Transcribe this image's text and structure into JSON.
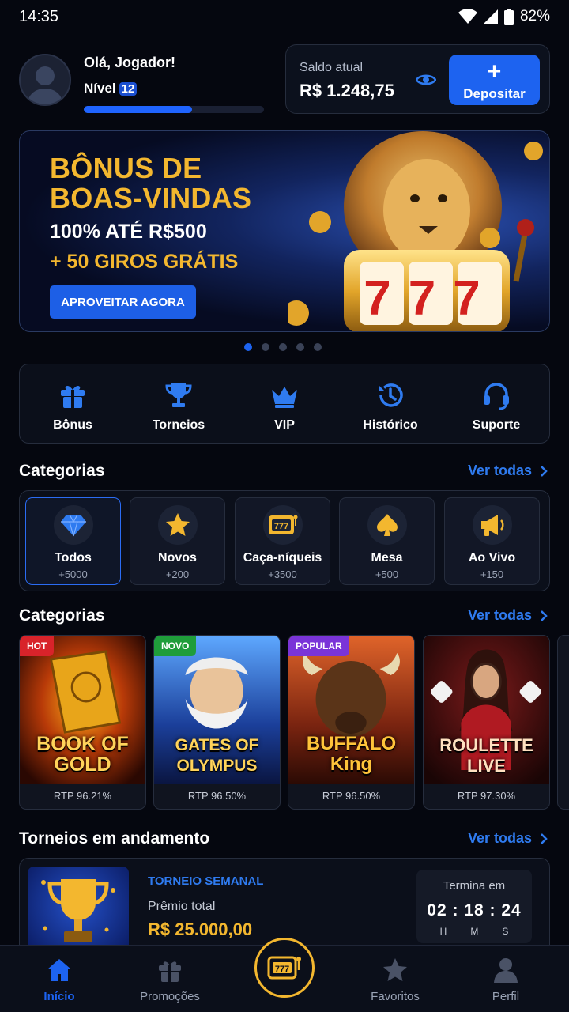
{
  "status_bar": {
    "time": "14:35",
    "battery": "82%"
  },
  "user": {
    "greeting": "Olá, Jogador!",
    "level_label": "Nível",
    "level": "12",
    "xp_progress": 0.6
  },
  "balance": {
    "label": "Saldo atual",
    "value": "R$ 1.248,75",
    "deposit_label": "Depositar"
  },
  "banner": {
    "title_line1": "BÔNUS DE",
    "title_line2": "BOAS-VINDAS",
    "line1": "100% ATÉ R$500",
    "line2": "+ 50 GIROS GRÁTIS",
    "cta": "APROVEITAR AGORA",
    "slot_digits": "777",
    "slides": 5,
    "active_slide": 1
  },
  "quick_actions": [
    {
      "label": "Bônus",
      "icon": "gift-icon"
    },
    {
      "label": "Torneios",
      "icon": "trophy-icon"
    },
    {
      "label": "VIP",
      "icon": "crown-icon"
    },
    {
      "label": "Histórico",
      "icon": "history-icon"
    },
    {
      "label": "Suporte",
      "icon": "headset-icon"
    }
  ],
  "categories_section": {
    "title": "Categorias",
    "see_all": "Ver todas"
  },
  "categories": [
    {
      "name": "Todos",
      "count": "+5000",
      "icon": "diamond-icon",
      "selected": true
    },
    {
      "name": "Novos",
      "count": "+200",
      "icon": "star-icon"
    },
    {
      "name": "Caça-níqueis",
      "count": "+3500",
      "icon": "slot-machine-icon"
    },
    {
      "name": "Mesa",
      "count": "+500",
      "icon": "spade-icon"
    },
    {
      "name": "Ao Vivo",
      "count": "+150",
      "icon": "megaphone-icon"
    }
  ],
  "games_section": {
    "title": "Categorias",
    "see_all": "Ver todas"
  },
  "games": [
    {
      "tag": "HOT",
      "name_line1": "BOOK OF",
      "name_line2": "GOLD",
      "rtp": "RTP 96.21%",
      "tag_color": "#d8232a"
    },
    {
      "tag": "NOVO",
      "name_line1": "GATES OF",
      "name_line2": "OLYMPUS",
      "rtp": "RTP 96.50%",
      "tag_color": "#1f9d3a"
    },
    {
      "tag": "POPULAR",
      "name_line1": "BUFFALO",
      "name_line2": "King",
      "rtp": "RTP 96.50%",
      "tag_color": "#7a34d8"
    },
    {
      "tag": "",
      "name_line1": "ROULETTE",
      "name_line2": "LIVE",
      "rtp": "RTP 97.30%",
      "tag_color": ""
    }
  ],
  "tournaments_section": {
    "title": "Torneios em andamento",
    "see_all": "Ver todas"
  },
  "tournament": {
    "name": "TORNEIO SEMANAL",
    "prize_label": "Prêmio total",
    "prize": "R$ 25.000,00",
    "ends_label": "Termina em",
    "countdown": "02 : 18 : 24",
    "units": [
      "H",
      "M",
      "S"
    ]
  },
  "bottom_nav": [
    {
      "label": "Início",
      "icon": "home-icon",
      "active": true
    },
    {
      "label": "Promoções",
      "icon": "gift-icon"
    },
    {
      "label": "Favoritos",
      "icon": "star-icon"
    },
    {
      "label": "Perfil",
      "icon": "user-icon"
    }
  ],
  "colors": {
    "accent": "#1d63f0",
    "gold": "#f3b72f",
    "background": "#05070f",
    "card": "#0b0f1a"
  }
}
